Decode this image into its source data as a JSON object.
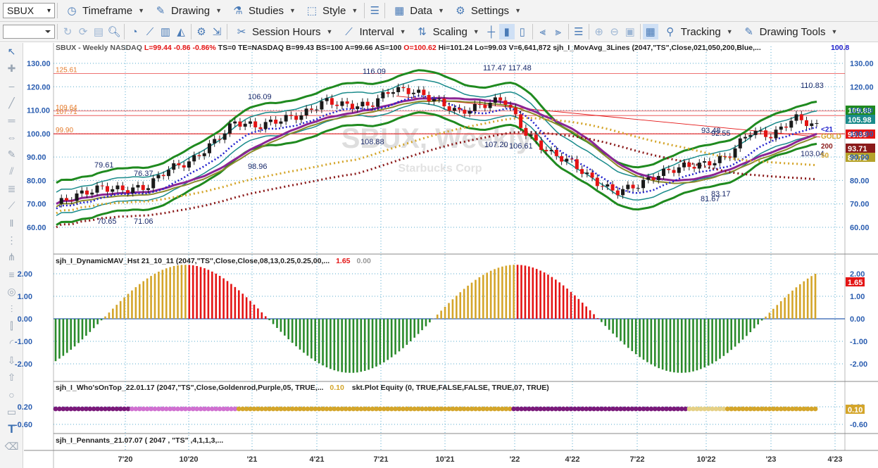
{
  "toolbar": {
    "symbol": "SBUX",
    "timeframe": "Timeframe",
    "drawing": "Drawing",
    "studies": "Studies",
    "style": "Style",
    "data": "Data",
    "settings": "Settings",
    "session_hours": "Session Hours",
    "interval": "Interval",
    "scaling": "Scaling",
    "tracking": "Tracking",
    "drawing_tools": "Drawing Tools"
  },
  "price_pane": {
    "header": {
      "title": "SBUX - Weekly  NASDAQ",
      "last": "L=99.44",
      "chg": "-0.86",
      "pct": "-0.86%",
      "rest1": "TS=0  TE=NASDAQ  B=99.43  BS=100  A=99.66  AS=100",
      "open": "O=100.62",
      "rest2": "Hi=101.24  Lo=99.03  V=6,641,872  sjh_I_MovAvg_3Lines (2047,\"TS\",Close,021,050,200,Blue,...",
      "tail": "100.8"
    },
    "watermark": "SBUX, Weekly",
    "watermark_sub": "Starbucks Corp",
    "y_ticks": [
      "130.00",
      "120.00",
      "110.00",
      "100.00",
      "90.00",
      "80.00",
      "70.00",
      "60.00"
    ],
    "left_levels": [
      "125.61",
      "109.64",
      "107.71",
      "99.90"
    ],
    "annotations": [
      "116.09",
      "117.47 117.48",
      "106.09",
      "110.83",
      "79.61",
      "76.37",
      "108.88",
      "107.20",
      "106.61",
      "98.96",
      "93.48",
      "92.55",
      "103.04",
      "83.17",
      "81.67",
      "70.65",
      "71.06"
    ],
    "ma_labels": [
      "<21",
      "GOLD",
      "200",
      "50"
    ],
    "badges": [
      {
        "text": "109.88",
        "bg": "#1f8a1f"
      },
      {
        "text": "105.98",
        "bg": "#1a8b8b"
      },
      {
        "text": "99.38",
        "bg": "#e41414"
      },
      {
        "text": "93.71",
        "bg": "#8b1a1a"
      },
      {
        "text": "89.72",
        "bg": "#b5a22a"
      }
    ]
  },
  "osc_pane": {
    "header": "sjh_I_DynamicMAV_Hst 21_10_11 (2047,\"TS\",Close,Close,08,13,0.25,0.25,00,...",
    "v1": "1.65",
    "v2": "0.00",
    "y_ticks": [
      "2.00",
      "1.00",
      "0.00",
      "-1.00",
      "-2.00"
    ],
    "badge": "1.65"
  },
  "who_pane": {
    "header": "sjh_I_Who'sOnTop_22.01.17 (2047,\"TS\",Close,Goldenrod,Purple,05, TRUE,...",
    "v1": "0.10",
    "extra": "skt.Plot Equity (0, TRUE,FALSE,FALSE, TRUE,07, TRUE)",
    "y_ticks": [
      "0.20",
      "-0.60"
    ],
    "badge": "0.10"
  },
  "pennant_pane": {
    "header": "sjh_I_Pennants_21.07.07 ( 2047 , \"TS\" ,4,1,1,3,..."
  },
  "x_ticks": [
    "7'20",
    "10'20",
    "'21",
    "4'21",
    "7'21",
    "10'21",
    "'22",
    "4'22",
    "7'22",
    "10'22",
    "'23",
    "4'23"
  ],
  "colors": {
    "up": "#1a1a1a",
    "down": "#e41414",
    "green": "#1f8a1f",
    "teal": "#1a8b8b",
    "purple": "#8b2595",
    "gold": "#d4a52a",
    "blue": "#2020cc",
    "maroon": "#8b1a1a",
    "hist_green": "#2a8a2a",
    "hist_purple": "#8b1a9b",
    "hist_red": "#e41414",
    "hist_gold": "#d4a52a"
  },
  "chart_data": {
    "type": "candlestick",
    "price_series": [
      {
        "date": "2020-04",
        "close": 70
      },
      {
        "date": "2020-05",
        "close": 74
      },
      {
        "date": "2020-06",
        "close": 77
      },
      {
        "date": "2020-07",
        "close": 76
      },
      {
        "date": "2020-08",
        "close": 77
      },
      {
        "date": "2020-09",
        "close": 85
      },
      {
        "date": "2020-10",
        "close": 88
      },
      {
        "date": "2020-11",
        "close": 96
      },
      {
        "date": "2020-12",
        "close": 105
      },
      {
        "date": "2021-01",
        "close": 103
      },
      {
        "date": "2021-02",
        "close": 106
      },
      {
        "date": "2021-03",
        "close": 108
      },
      {
        "date": "2021-04",
        "close": 114
      },
      {
        "date": "2021-05",
        "close": 112
      },
      {
        "date": "2021-06",
        "close": 112
      },
      {
        "date": "2021-07",
        "close": 119
      },
      {
        "date": "2021-08",
        "close": 118
      },
      {
        "date": "2021-09",
        "close": 114
      },
      {
        "date": "2021-10",
        "close": 109
      },
      {
        "date": "2021-11",
        "close": 112
      },
      {
        "date": "2021-12",
        "close": 115
      },
      {
        "date": "2022-01",
        "close": 100
      },
      {
        "date": "2022-02",
        "close": 92
      },
      {
        "date": "2022-03",
        "close": 88
      },
      {
        "date": "2022-04",
        "close": 80
      },
      {
        "date": "2022-05",
        "close": 75
      },
      {
        "date": "2022-06",
        "close": 78
      },
      {
        "date": "2022-07",
        "close": 83
      },
      {
        "date": "2022-08",
        "close": 86
      },
      {
        "date": "2022-09",
        "close": 87
      },
      {
        "date": "2022-10",
        "close": 90
      },
      {
        "date": "2022-11",
        "close": 101
      },
      {
        "date": "2022-12",
        "close": 99
      },
      {
        "date": "2023-01",
        "close": 107
      },
      {
        "date": "2023-02",
        "close": 103
      }
    ]
  }
}
